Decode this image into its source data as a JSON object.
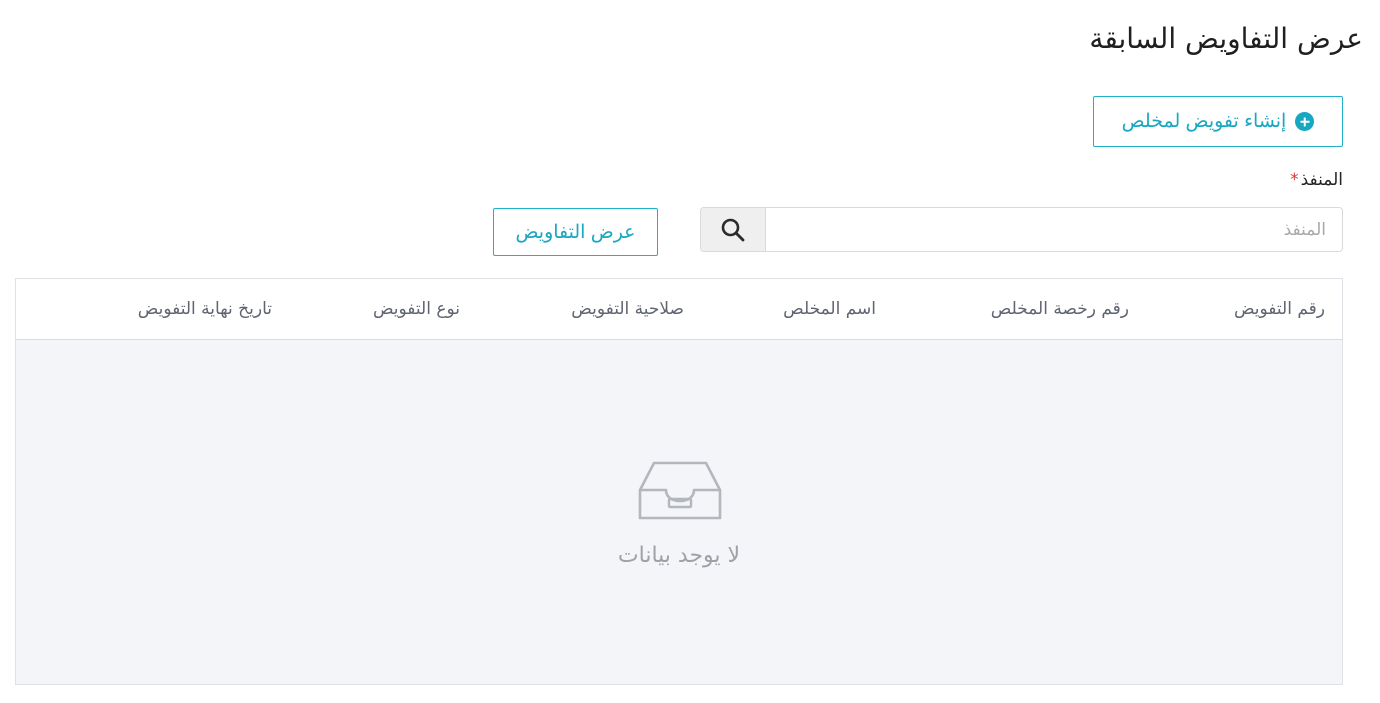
{
  "page": {
    "title": "عرض التفاويض السابقة"
  },
  "actions": {
    "create_label": "إنشاء تفويض لمخلص",
    "create_icon": "plus-circle-icon",
    "view_label": "عرض التفاويض"
  },
  "filter": {
    "label": "المنفذ",
    "required_mark": "*",
    "value": "",
    "placeholder": "المنفذ",
    "search_icon": "search-icon"
  },
  "table": {
    "columns": [
      "رقم التفويض",
      "رقم رخصة المخلص",
      "اسم المخلص",
      "صلاحية التفويض",
      "نوع التفويض",
      "تاريخ نهاية التفويض"
    ],
    "rows": [],
    "empty_icon": "inbox-icon",
    "empty_text": "لا يوجد بيانات"
  },
  "colors": {
    "accent": "#18a7c0",
    "required": "#e0352f",
    "table_body_bg": "#f4f5f8",
    "empty_text": "#9ea1a8"
  }
}
